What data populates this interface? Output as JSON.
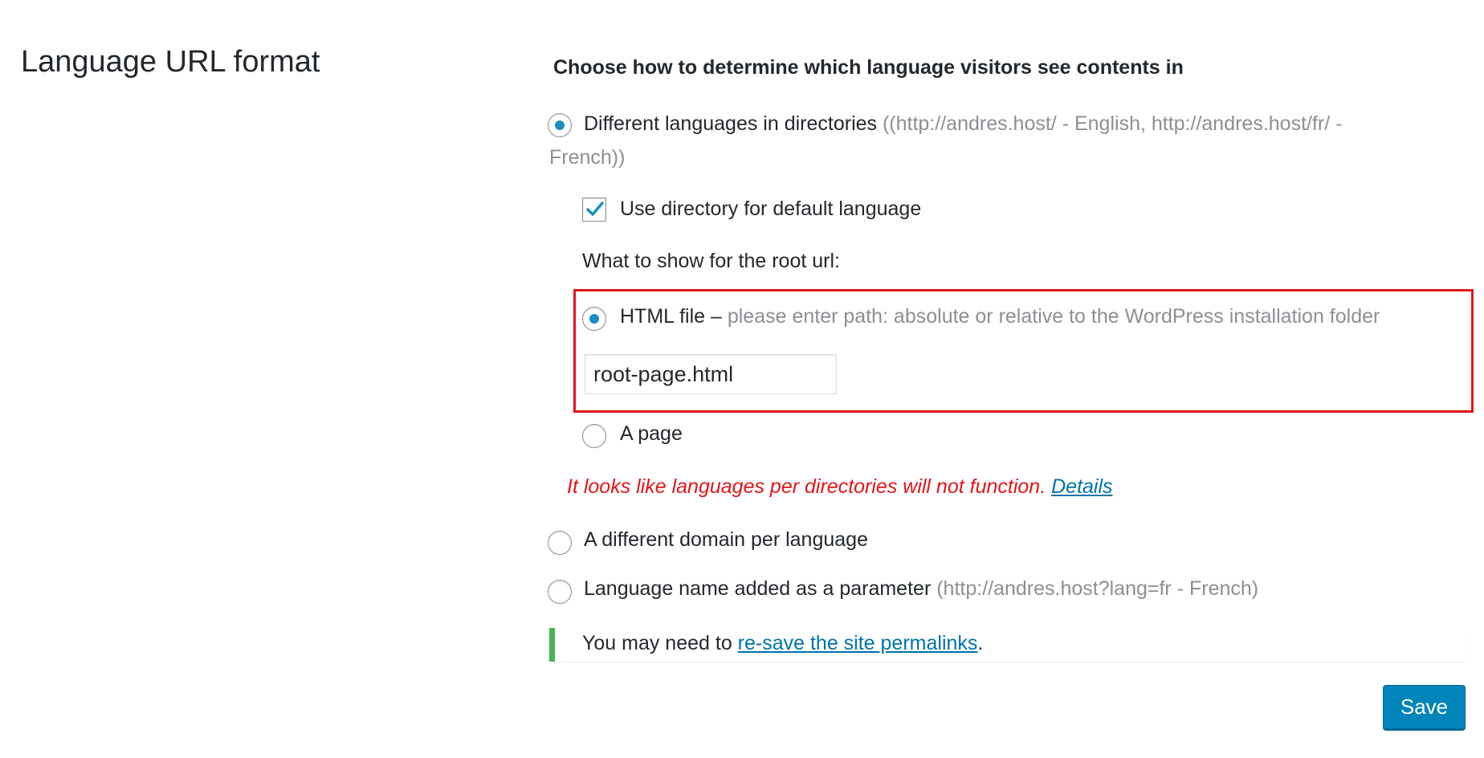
{
  "section": {
    "title": "Language URL format"
  },
  "main": {
    "heading": "Choose how to determine which language visitors see contents in",
    "options": [
      {
        "label": "Different languages in directories",
        "hint_line1": "((http://andres.host/ - English, http://andres.host/fr/ -",
        "hint_line2": "French))",
        "selected": true
      },
      {
        "label": "A different domain per language",
        "selected": false
      },
      {
        "label": "Language name added as a parameter",
        "hint": "(http://andres.host?lang=fr - French)",
        "selected": false
      }
    ],
    "directory_default": {
      "label": "Use directory for default language",
      "checked": true
    },
    "root_url": {
      "label": "What to show for the root url:",
      "html_file": {
        "label": "HTML file –",
        "hint": "please enter path: absolute or relative to the WordPress installation folder",
        "selected": true
      },
      "path_value": "root-page.html",
      "a_page": {
        "label": "A page",
        "selected": false
      }
    },
    "warning": {
      "text": "It looks like languages per directories will not function.",
      "link": "Details"
    },
    "notice": {
      "prefix": "You may need to",
      "link": "re-save the site permalinks",
      "suffix": "."
    },
    "save_label": "Save"
  },
  "colors": {
    "accent": "#0085ba",
    "link": "#0073aa",
    "warning": "#e0161c",
    "notice_border": "#46b450",
    "radio_dot": "#1e8cbe"
  }
}
